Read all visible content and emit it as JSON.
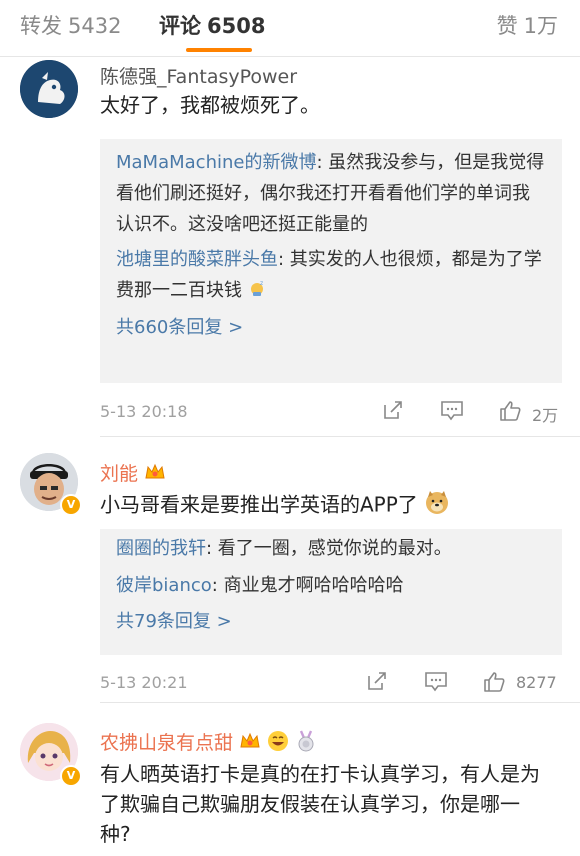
{
  "tabs": {
    "repost": {
      "label": "转发",
      "count": "5432"
    },
    "comment": {
      "label": "评论",
      "count": "6508"
    },
    "like": {
      "label": "赞",
      "count": "1万"
    }
  },
  "colors": {
    "accent": "#ff8200",
    "link": "#4a79a8",
    "vip_name": "#eb7350"
  },
  "comments": [
    {
      "name": "陈德强_FantasyPower",
      "text": "太好了，我都被烦死了。",
      "replies": [
        {
          "name": "MaMaMachine的新微博",
          "text": ": 虽然我没参与，但是我觉得看他们刷还挺好，偶尔我还打开看看他们学的单词我认识不。这没啥吧还挺正能量的"
        },
        {
          "name": "池塘里的酸菜胖头鱼",
          "text": ": 其实发的人也很烦，都是为了学费那一二百块钱"
        }
      ],
      "more": "共660条回复 >",
      "time": "5-13 20:18",
      "likes": "2万"
    },
    {
      "name": "刘能",
      "text": "小马哥看来是要推出学英语的APP了",
      "replies": [
        {
          "name": "圈圈的我轩",
          "text": ": 看了一圈，感觉你说的最对。"
        },
        {
          "name": "彼岸bianco",
          "text": ": 商业鬼才啊哈哈哈哈哈"
        }
      ],
      "more": "共79条回复 >",
      "time": "5-13 20:21",
      "likes": "8277"
    },
    {
      "name": "农拂山泉有点甜",
      "text": "有人晒英语打卡是真的在打卡认真学习，有人是为了欺骗自己欺骗朋友假装在认真学习，你是哪一种?"
    }
  ],
  "icons": [
    "repost-icon",
    "comment-icon",
    "like-icon",
    "crown-icon",
    "doge-emoji",
    "grin-emoji",
    "medal-icon",
    "verified-badge",
    "sleep-emoji"
  ]
}
